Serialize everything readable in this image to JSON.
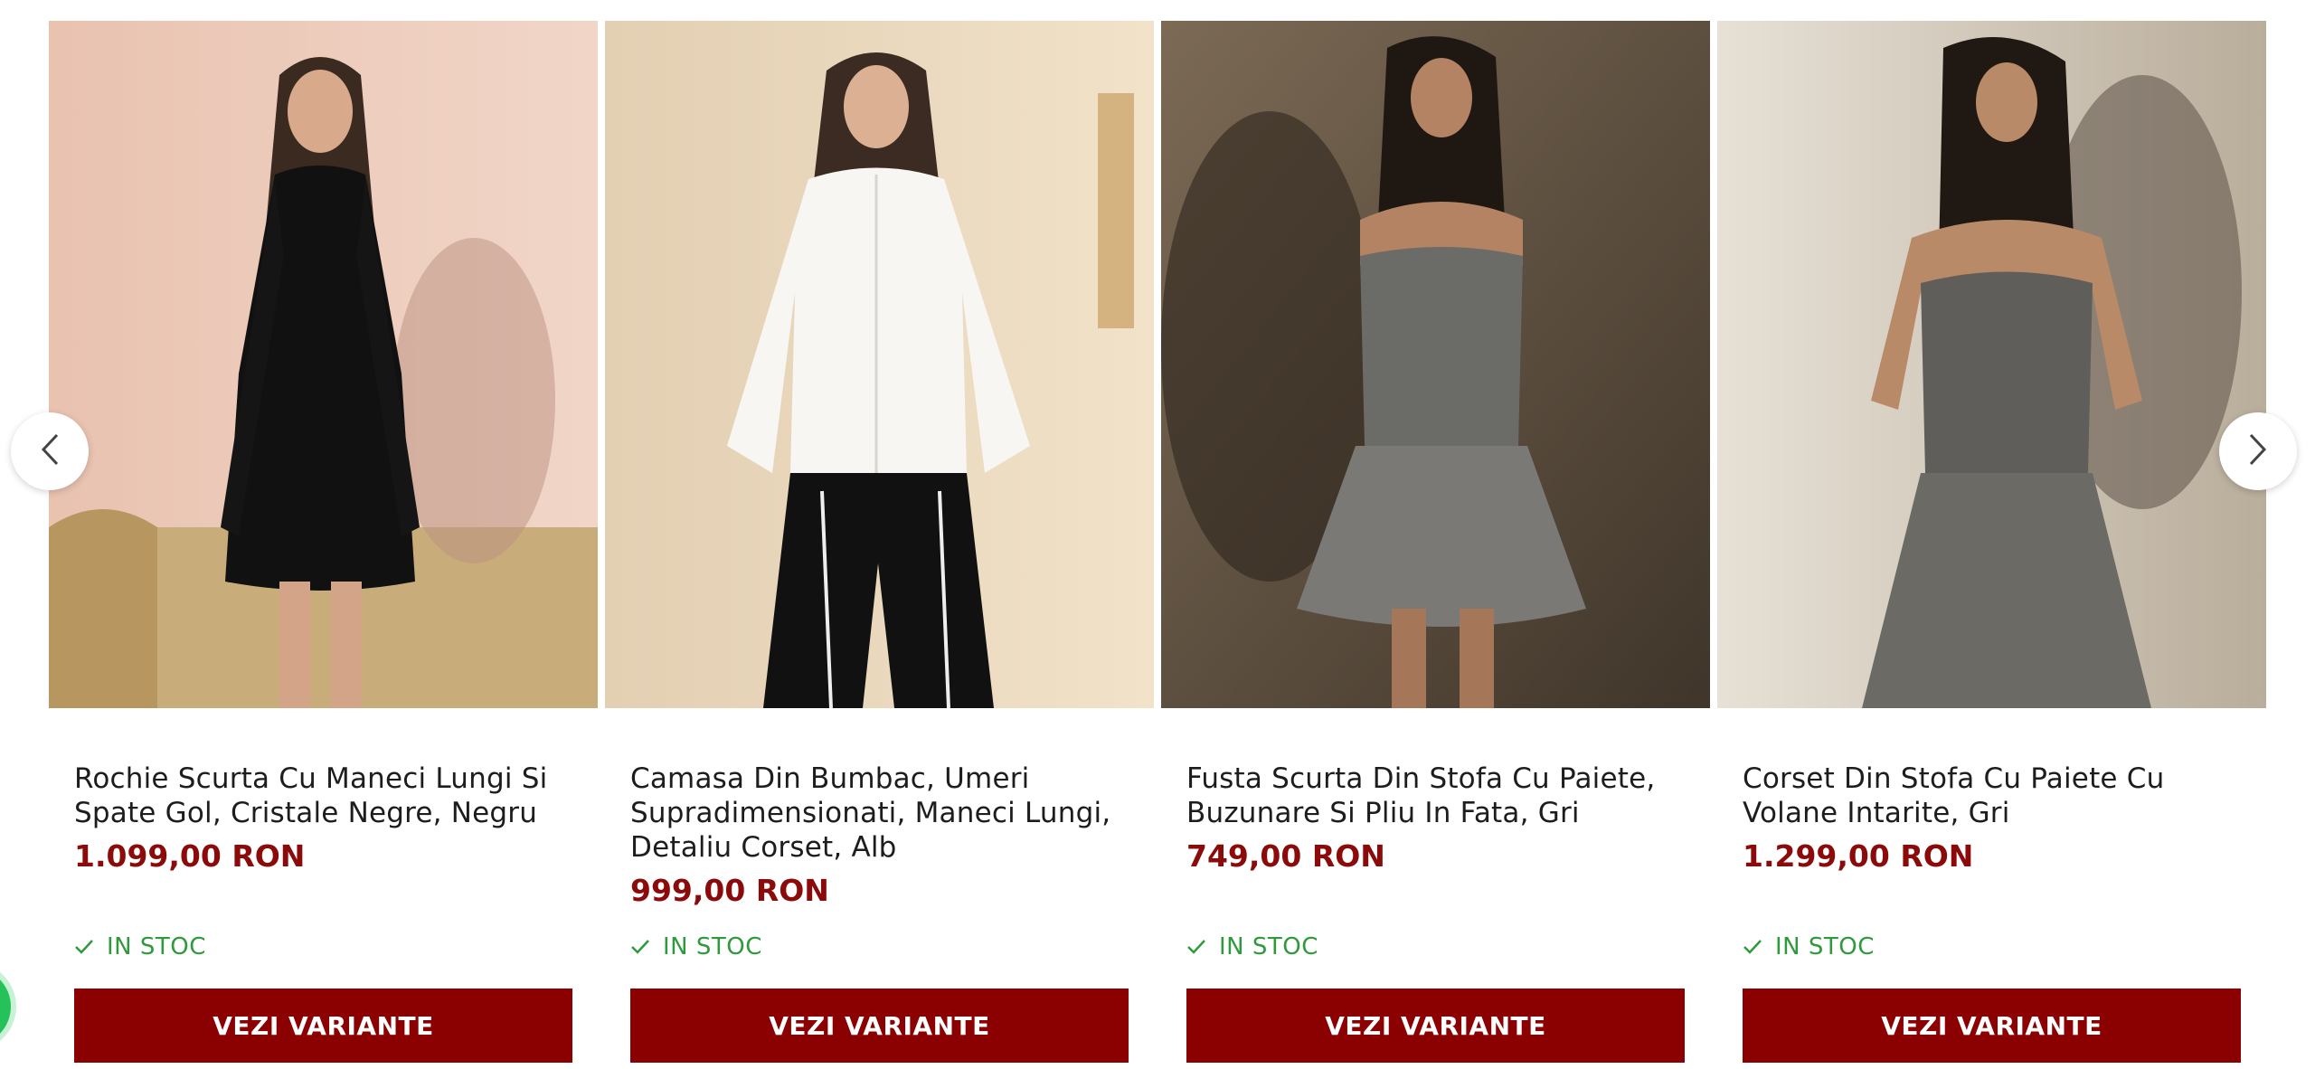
{
  "carousel": {
    "prev_icon": "chevron-left-icon",
    "next_icon": "chevron-right-icon",
    "products": [
      {
        "title": "Rochie Scurta Cu Maneci Lungi Si Spate Gol, Cristale Negre, Negru",
        "price": "1.099,00 RON",
        "stock": "IN STOC",
        "button": "VEZI VARIANTE"
      },
      {
        "title": "Camasa Din Bumbac, Umeri Supradimensionati, Maneci Lungi, Detaliu Corset, Alb",
        "price": "999,00 RON",
        "stock": "IN STOC",
        "button": "VEZI VARIANTE"
      },
      {
        "title": "Fusta Scurta Din Stofa Cu Paiete, Buzunare Si Pliu In Fata, Gri",
        "price": "749,00 RON",
        "stock": "IN STOC",
        "button": "VEZI VARIANTE"
      },
      {
        "title": "Corset Din Stofa Cu Paiete Cu Volane Intarite, Gri",
        "price": "1.299,00 RON",
        "stock": "IN STOC",
        "button": "VEZI VARIANTE"
      }
    ]
  },
  "colors": {
    "price": "#8b0a0a",
    "button": "#8b0000",
    "stock": "#2e9a3c",
    "chat": "#25c25a"
  },
  "chat_icon": "whatsapp-icon"
}
